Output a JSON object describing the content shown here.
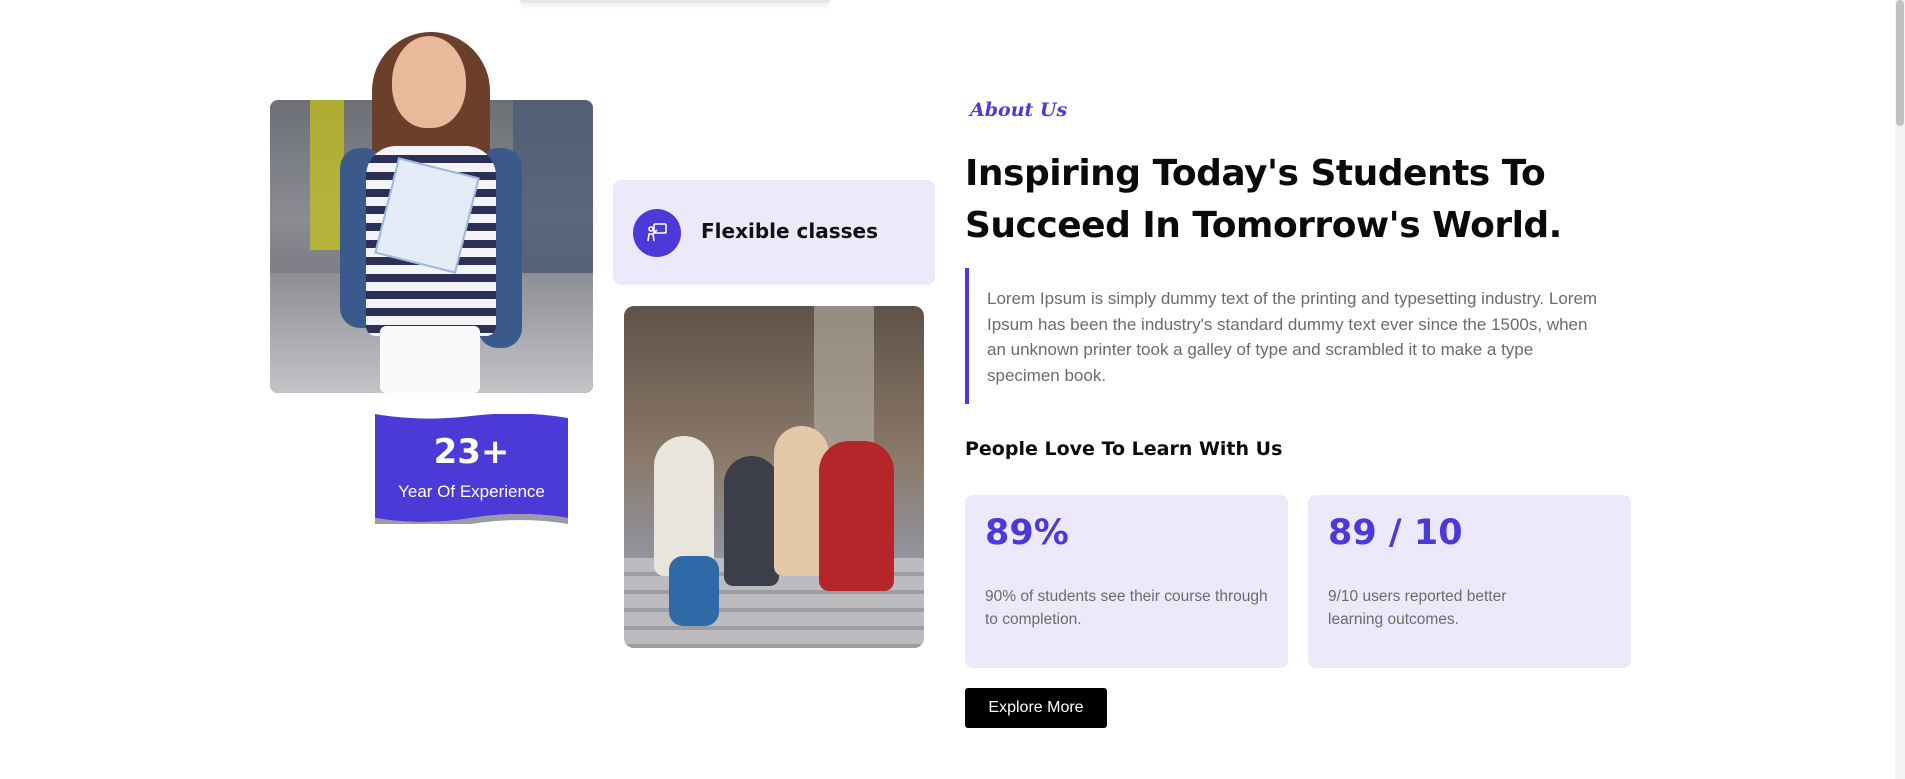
{
  "about": {
    "tag": "About Us",
    "headline": "Inspiring Today's Students To Succeed In Tomorrow's World.",
    "description": "Lorem Ipsum is simply dummy text of the printing and typesetting industry. Lorem Ipsum has been the industry's standard dummy text ever since the 1500s, when an unknown printer took a galley of type and scrambled it to make a type specimen book.",
    "subheading": "People Love To Learn With Us"
  },
  "experience": {
    "number": "23+",
    "label": "Year Of Experience"
  },
  "feature": {
    "label": "Flexible classes",
    "icon": "teacher-board-icon"
  },
  "stats": [
    {
      "value": "89%",
      "description": "90% of students see their course through to completion."
    },
    {
      "value": "89 / 10",
      "description": "9/10 users reported better learning outcomes."
    }
  ],
  "cta": {
    "label": "Explore More"
  },
  "colors": {
    "accent": "#4b3ad8",
    "card_bg": "#ede9fb",
    "button_bg": "#000000"
  }
}
